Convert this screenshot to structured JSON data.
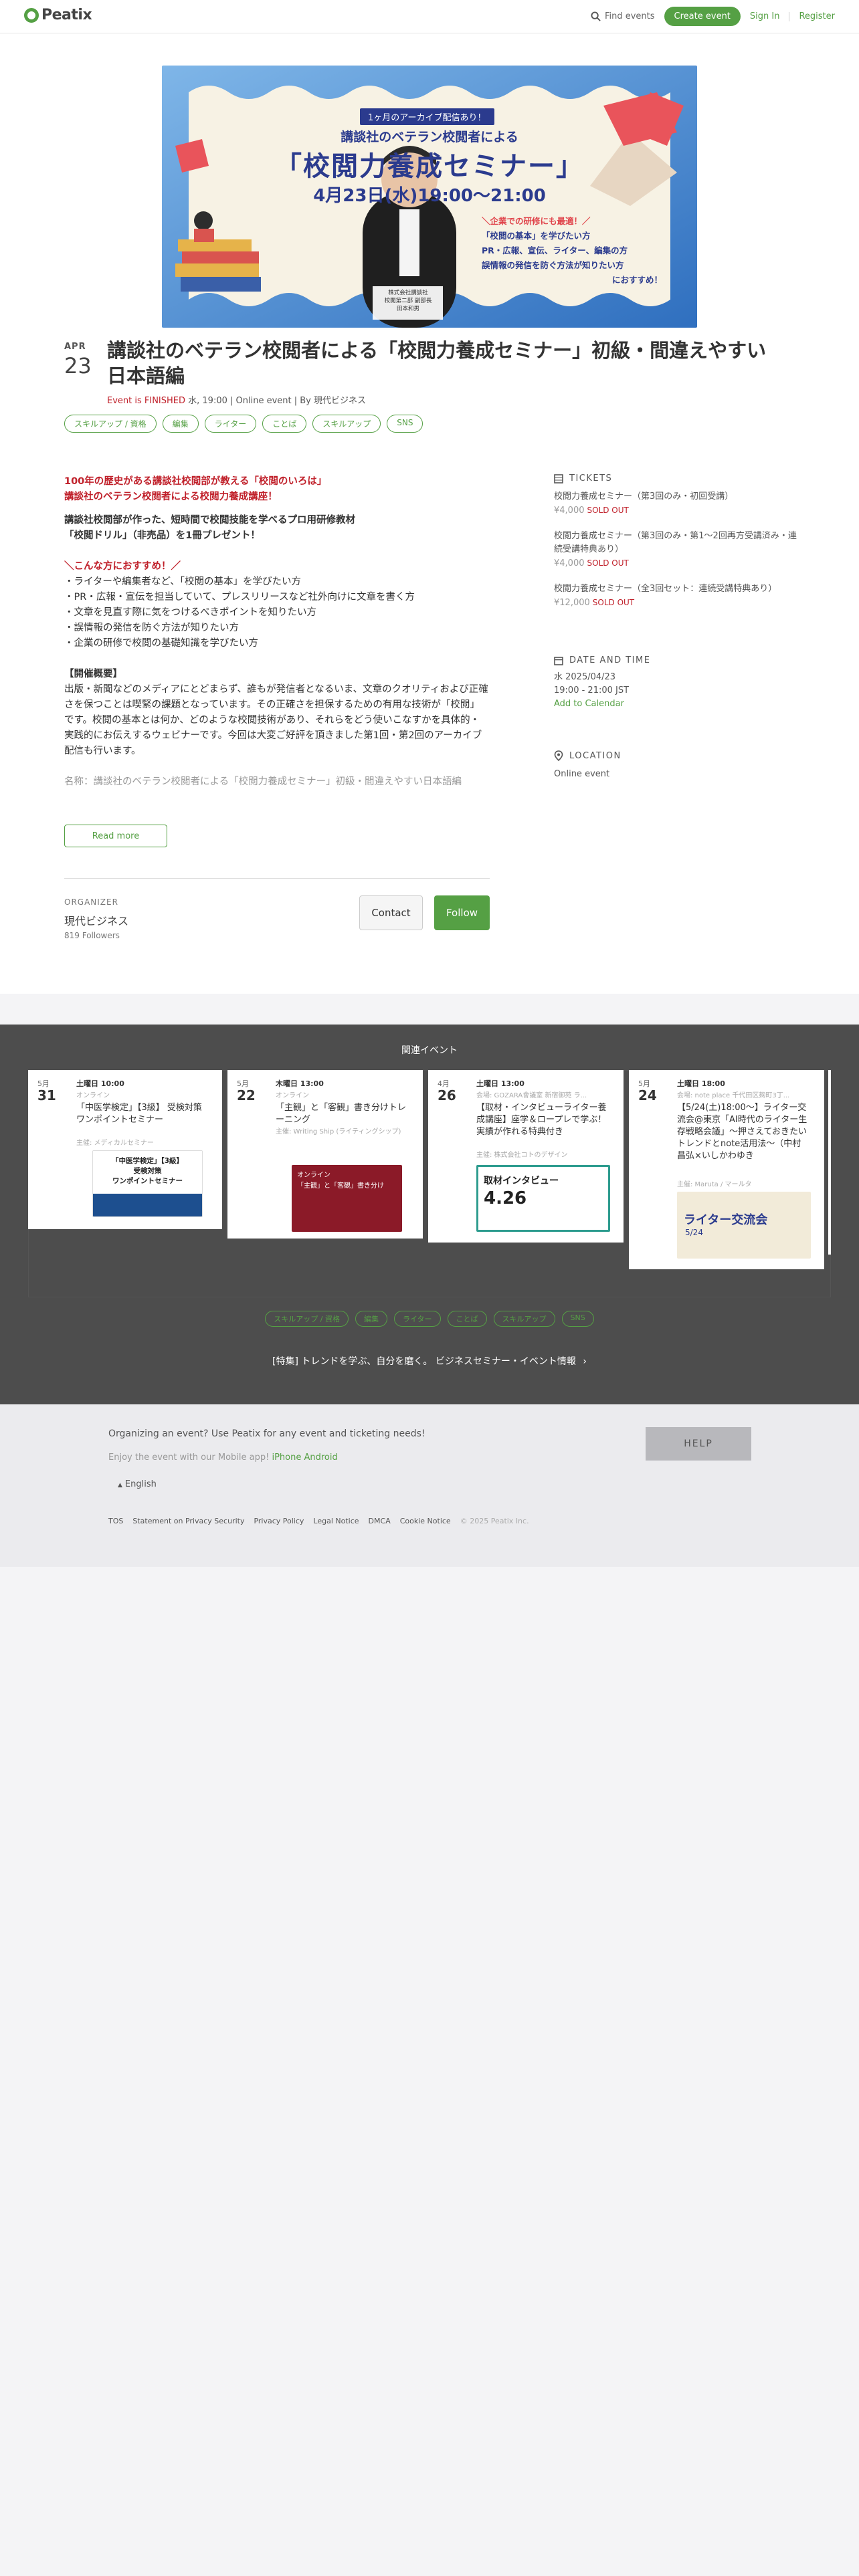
{
  "header": {
    "logo": "Peatix",
    "find_events": "Find events",
    "create_event": "Create event",
    "sign_in": "Sign In",
    "register": "Register"
  },
  "hero": {
    "badge": "1ヶ月のアーカイブ配信あり！",
    "line1": "講談社のベテラン校閲者による",
    "line2": "「校閲力養成セミナー」",
    "datetime": "4月23日(水)19:00〜21:00",
    "bubble": [
      "＼企業での研修にも最適！／",
      "「校閲の基本」を学びたい方",
      "PR・広報、宣伝、ライター、編集の方",
      "誤情報の発信を防ぐ方法が知りたい方",
      "におすすめ！"
    ],
    "presenter": [
      "株式会社講談社",
      "校閲第二部 副部長",
      "田本和男"
    ]
  },
  "event": {
    "month": "APR",
    "day": "23",
    "title": "講談社のベテラン校閲者による「校閲力養成セミナー」初級・間違えやすい日本語編",
    "status": "Event is FINISHED",
    "meta": " 水, 19:00 | Online event | By 現代ビジネス",
    "tags": [
      "スキルアップ / 資格",
      "編集",
      "ライター",
      "ことば",
      "スキルアップ",
      "SNS"
    ]
  },
  "description": {
    "p1a": "100年の歴史がある講談社校閲部が教える「校閲のいろは」",
    "p1b": "講談社のベテラン校閲者による校閲力養成講座！",
    "p2a": "講談社校閲部が作った、短時間で校閲技能を学べるプロ用研修教材",
    "p2b": "「校閲ドリル」（非売品）を1冊プレゼント！",
    "p3h": "＼こんな方におすすめ！／",
    "list": [
      "・ライターや編集者など、「校閲の基本」を学びたい方",
      "・PR・広報・宣伝を担当していて、プレスリリースなど社外向けに文章を書く方",
      "・文章を見直す際に気をつけるべきポイントを知りたい方",
      "・誤情報の発信を防ぐ方法が知りたい方",
      "・企業の研修で校閲の基礎知識を学びたい方"
    ],
    "p4h": "【開催概要】",
    "p4": "出版・新聞などのメディアにとどまらず、誰もが発信者となるいま、文章のクオリティおよび正確さを保つことは喫緊の課題となっています。その正確さを担保するための有用な技術が「校閲」です。校閲の基本とは何か、どのような校閲技術があり、それらをどう使いこなすかを具体的・実践的にお伝えするウェビナーです。今回は大変ご好評を頂きました第1回・第2回のアーカイブ配信も行います。",
    "p5": "名称：講談社のベテラン校閲者による「校閲力養成セミナー」初級・間違えやすい日本語編",
    "read_more": "Read more"
  },
  "organizer": {
    "label": "ORGANIZER",
    "name": "現代ビジネス",
    "followers": "819 Followers",
    "contact": "Contact",
    "follow": "Follow"
  },
  "sidebar": {
    "tickets_h": "TICKETS",
    "tickets": [
      {
        "name": "校閲力養成セミナー（第3回のみ・初回受講）",
        "price": "¥4,000",
        "status": "SOLD OUT"
      },
      {
        "name": "校閲力養成セミナー（第3回のみ・第1〜2回再方受講済み・連続受講特典あり）",
        "price": "¥4,000",
        "status": "SOLD OUT"
      },
      {
        "name": "校閲力養成セミナー（全3回セット：連続受講特典あり）",
        "price": "¥12,000",
        "status": "SOLD OUT"
      }
    ],
    "date_h": "DATE AND TIME",
    "date": "水 2025/04/23",
    "time": "19:00 - 21:00 JST",
    "add_cal": "Add to Calendar",
    "loc_h": "LOCATION",
    "loc": "Online event"
  },
  "related": {
    "heading": "関連イベント",
    "cards": [
      {
        "month": "5月",
        "day": "31",
        "when": "土曜日 10:00",
        "venue": "オンライン",
        "title": "「中医学検定」【3級】 受検対策ワンポイントセミナー",
        "org": "主催: メディカルセミナー",
        "img": [
          "「中医学検定」【3級】",
          "受検対策",
          "ワンポイントセミナー"
        ]
      },
      {
        "month": "5月",
        "day": "22",
        "when": "木曜日 13:00",
        "venue": "オンライン",
        "title": "「主観」と「客観」書き分けトレーニング",
        "org": "主催: Writing Ship (ライティングシップ)",
        "img": [
          "オンライン",
          "「主観」と「客観」書き分け"
        ]
      },
      {
        "month": "4月",
        "day": "26",
        "when": "土曜日 13:00",
        "venue": "会場: GOZARA會議室 新宿御苑 ラ...",
        "title": "【取材・インタビューライター養成講座】座学＆ロープレで学ぶ！実績が作れる特典付き",
        "org": "主催: 株式会社コトのデザイン",
        "img": [
          "取材インタビュー",
          "4.26"
        ]
      },
      {
        "month": "5月",
        "day": "24",
        "when": "土曜日 18:00",
        "venue": "会場: note place 千代田区麹町3丁...",
        "title": "【5/24(土)18:00〜】ライター交流会@東京「AI時代のライター生存戦略会議」〜押さえておきたいトレンドとnote活用法〜（中村昌弘×いしかわゆき",
        "org": "主催: Maruta / マールタ",
        "img": [
          "ライター交流会",
          "5/24"
        ]
      }
    ],
    "tags": [
      "スキルアップ / 資格",
      "編集",
      "ライター",
      "ことば",
      "スキルアップ",
      "SNS"
    ],
    "feature": "[特集] トレンドを学ぶ、自分を磨く。 ビジネスセミナー・イベント情報"
  },
  "footer": {
    "organizing": "Organizing an event? Use Peatix for any event and ticketing needs!",
    "mobile_pre": "Enjoy the event with our Mobile app! ",
    "iphone": "iPhone",
    "android": "Android",
    "help": "HELP",
    "lang": "English",
    "links": [
      "TOS",
      "Statement on Privacy Security",
      "Privacy Policy",
      "Legal Notice",
      "DMCA",
      "Cookie Notice"
    ],
    "copy": "© 2025 Peatix Inc."
  }
}
